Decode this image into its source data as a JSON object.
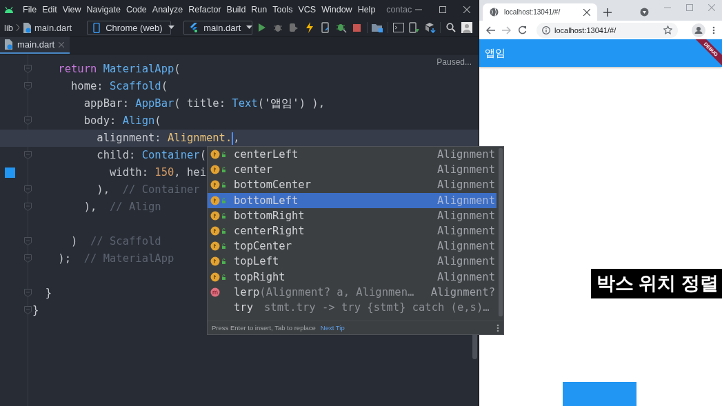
{
  "ide": {
    "menu": [
      "File",
      "Edit",
      "View",
      "Navigate",
      "Code",
      "Analyze",
      "Refactor",
      "Build",
      "Run",
      "Tools",
      "VCS",
      "Window",
      "Help"
    ],
    "project_name": "contac",
    "breadcrumb": [
      "lib",
      "main.dart"
    ],
    "device": "Chrome (web)",
    "run_config": "main.dart",
    "tabs": [
      {
        "label": "main.dart",
        "selected": true
      }
    ],
    "status": "Paused...",
    "code_lines": [
      {
        "fold": true,
        "current": false,
        "swatch": false,
        "tokens": [
          {
            "kind": "keyword",
            "text": "    return "
          },
          {
            "kind": "type",
            "text": "MaterialApp"
          },
          {
            "kind": "plain",
            "text": "("
          }
        ]
      },
      {
        "fold": true,
        "current": false,
        "swatch": false,
        "tokens": [
          {
            "kind": "plain",
            "text": "      home: "
          },
          {
            "kind": "type",
            "text": "Scaffold"
          },
          {
            "kind": "plain",
            "text": "("
          }
        ]
      },
      {
        "fold": false,
        "current": false,
        "swatch": false,
        "tokens": [
          {
            "kind": "plain",
            "text": "        appBar: "
          },
          {
            "kind": "type",
            "text": "AppBar"
          },
          {
            "kind": "plain",
            "text": "( title: "
          },
          {
            "kind": "type",
            "text": "Text"
          },
          {
            "kind": "plain",
            "text": "("
          },
          {
            "kind": "string",
            "text": "'앱임'"
          },
          {
            "kind": "plain",
            "text": ") ),"
          }
        ]
      },
      {
        "fold": true,
        "current": false,
        "swatch": false,
        "tokens": [
          {
            "kind": "plain",
            "text": "        body: "
          },
          {
            "kind": "type",
            "text": "Align"
          },
          {
            "kind": "plain",
            "text": "("
          }
        ]
      },
      {
        "fold": false,
        "current": true,
        "swatch": false,
        "tokens": [
          {
            "kind": "plain",
            "text": "          alignment: "
          },
          {
            "kind": "enum",
            "text": "Alignment."
          },
          {
            "kind": "caret"
          },
          {
            "kind": "plain",
            "text": ","
          }
        ]
      },
      {
        "fold": true,
        "current": false,
        "swatch": false,
        "tokens": [
          {
            "kind": "plain",
            "text": "          child: "
          },
          {
            "kind": "type",
            "text": "Container"
          },
          {
            "kind": "plain",
            "text": "("
          }
        ]
      },
      {
        "fold": false,
        "current": false,
        "swatch": true,
        "tokens": [
          {
            "kind": "plain",
            "text": "            width: "
          },
          {
            "kind": "number",
            "text": "150"
          },
          {
            "kind": "plain",
            "text": ", hei"
          }
        ]
      },
      {
        "fold": true,
        "current": false,
        "swatch": false,
        "tokens": [
          {
            "kind": "plain",
            "text": "          ),  "
          },
          {
            "kind": "comment",
            "text": "// Container"
          }
        ]
      },
      {
        "fold": true,
        "current": false,
        "swatch": false,
        "tokens": [
          {
            "kind": "plain",
            "text": "        ),  "
          },
          {
            "kind": "comment",
            "text": "// Align"
          }
        ]
      },
      {
        "fold": false,
        "current": false,
        "swatch": false
      },
      {
        "fold": true,
        "current": false,
        "swatch": false,
        "tokens": [
          {
            "kind": "plain",
            "text": "      )  "
          },
          {
            "kind": "comment",
            "text": "// Scaffold"
          }
        ]
      },
      {
        "fold": true,
        "current": false,
        "swatch": false,
        "tokens": [
          {
            "kind": "plain",
            "text": "    );  "
          },
          {
            "kind": "comment",
            "text": "// MaterialApp"
          }
        ]
      },
      {
        "fold": false,
        "current": false,
        "swatch": false
      },
      {
        "fold": true,
        "current": false,
        "swatch": false,
        "tokens": [
          {
            "kind": "plain",
            "text": "  }"
          }
        ]
      },
      {
        "fold": true,
        "current": false,
        "swatch": false,
        "tokens": [
          {
            "kind": "plain",
            "text": "}"
          }
        ]
      }
    ],
    "completion": {
      "items": [
        {
          "kind": "field",
          "name": "centerLeft",
          "type": "Alignment",
          "selected": false
        },
        {
          "kind": "field",
          "name": "center",
          "type": "Alignment",
          "selected": false
        },
        {
          "kind": "field",
          "name": "bottomCenter",
          "type": "Alignment",
          "selected": false
        },
        {
          "kind": "field",
          "name": "bottomLeft",
          "type": "Alignment",
          "selected": true
        },
        {
          "kind": "field",
          "name": "bottomRight",
          "type": "Alignment",
          "selected": false
        },
        {
          "kind": "field",
          "name": "centerRight",
          "type": "Alignment",
          "selected": false
        },
        {
          "kind": "field",
          "name": "topCenter",
          "type": "Alignment",
          "selected": false
        },
        {
          "kind": "field",
          "name": "topLeft",
          "type": "Alignment",
          "selected": false
        },
        {
          "kind": "field",
          "name": "topRight",
          "type": "Alignment",
          "selected": false
        },
        {
          "kind": "method",
          "name": "lerp",
          "params": "(Alignment? a, Alignmen…",
          "type": "Alignment?",
          "selected": false
        },
        {
          "kind": "template",
          "name": "try",
          "params": "stmt.try -> try {stmt} catch (e,s)…",
          "selected": false
        }
      ],
      "hint": "Press Enter to insert, Tab to replace",
      "tip_link": "Next Tip"
    }
  },
  "browser": {
    "tab_title": "localhost:13041/#/",
    "url": "localhost:13041/#/",
    "app_bar_title": "앱임",
    "debug_banner": "DEBUG",
    "caption": "박스 위치 정렬"
  }
}
